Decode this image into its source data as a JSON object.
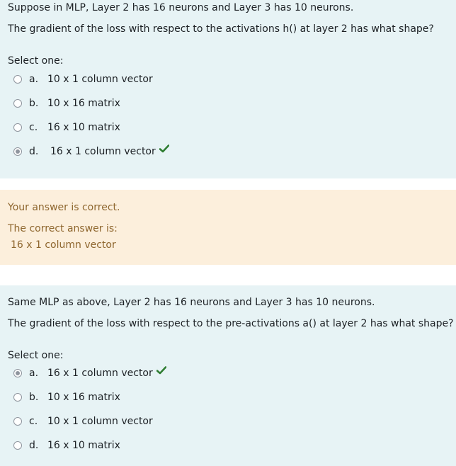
{
  "question1": {
    "line1": "Suppose in MLP, Layer 2 has 16 neurons and Layer 3 has 10 neurons.",
    "line2": "The gradient of the loss with respect to the activations h() at layer 2 has what shape?",
    "select_label": "Select one:",
    "options": [
      {
        "letter": "a.",
        "text": "10 x 1 column vector",
        "selected": false
      },
      {
        "letter": "b.",
        "text": "10 x 16 matrix",
        "selected": false
      },
      {
        "letter": "c.",
        "text": "16 x 10 matrix",
        "selected": false
      },
      {
        "letter": "d.",
        "text": "16 x 1 column vector",
        "selected": true
      }
    ]
  },
  "feedback": {
    "status": "Your answer is correct.",
    "correct_label": "The correct answer is:",
    "correct_answer": "16 x 1 column vector"
  },
  "question2": {
    "line1": "Same MLP as above, Layer 2 has 16 neurons and Layer 3 has 10 neurons.",
    "line2": "The gradient of the loss with respect to the pre-activations a() at layer 2 has what shape?",
    "select_label": "Select one:",
    "options": [
      {
        "letter": "a.",
        "text": "16 x 1 column vector",
        "selected": true
      },
      {
        "letter": "b.",
        "text": "10 x 16 matrix",
        "selected": false
      },
      {
        "letter": "c.",
        "text": "10 x 1 column vector",
        "selected": false
      },
      {
        "letter": "d.",
        "text": "16 x 10 matrix",
        "selected": false
      }
    ]
  },
  "colors": {
    "question_bg": "#e7f3f5",
    "feedback_bg": "#fcefdc",
    "feedback_text": "#8e662e",
    "check": "#2f7d32"
  },
  "icons": {
    "correct_mark": "check-icon",
    "radio": "radio-icon"
  }
}
